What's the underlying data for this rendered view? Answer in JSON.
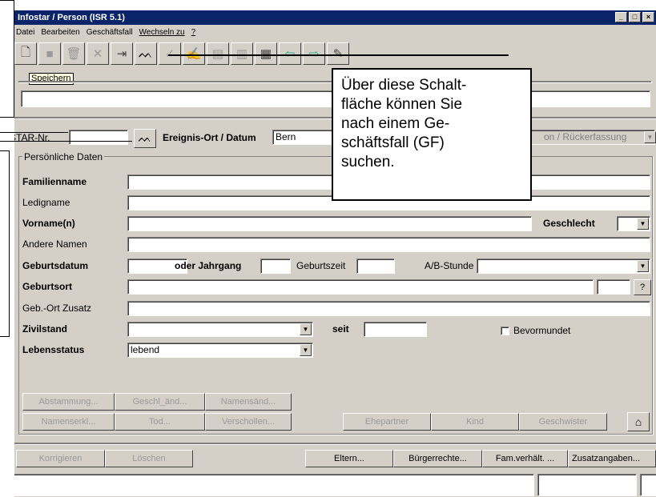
{
  "window": {
    "title": "Infostar / Person (ISR 5.1)",
    "min": "_",
    "max": "□",
    "close": "×"
  },
  "menu": [
    "Datei",
    "Bearbeiten",
    "Geschäftsfall",
    "Wechseln zu",
    "?"
  ],
  "toolbar": {
    "tooltip": "Speichern"
  },
  "search": {
    "star_label": "STAR-Nr.",
    "star_value": "",
    "ereignis_label": "Ereignis-Ort / Datum",
    "ereignis_value": "Bern",
    "combo_value": "on / Rückerfassung"
  },
  "section": {
    "title": "Persönliche Daten"
  },
  "labels": {
    "familienname": "Familienname",
    "ledigname": "Ledigname",
    "vorname": "Vorname(n)",
    "geschlecht": "Geschlecht",
    "andere": "Andere Namen",
    "geburtsdatum": "Geburtsdatum",
    "jahrgang": "oder Jahrgang",
    "geburtszeit": "Geburtszeit",
    "abstunde": "A/B-Stunde",
    "geburtsort": "Geburtsort",
    "zusatz": "Geb.-Ort Zusatz",
    "zivilstand": "Zivilstand",
    "seit": "seit",
    "bevormundet": "Bevormundet",
    "lebensstatus": "Lebensstatus"
  },
  "values": {
    "lebensstatus": "lebend",
    "geburtsort_btn": "?"
  },
  "buttons": {
    "abstammung": "Abstammung...",
    "geschl": "Geschl_änd...",
    "namensaend": "Namensänd...",
    "namenserkl": "Namenserkl...",
    "tod": "Tod...",
    "verschollen": "Verschollen...",
    "ehepartner": "Ehepartner",
    "kind": "Kind",
    "geschwister": "Geschwister",
    "korrigieren": "Korrigieren",
    "loeschen": "Löschen",
    "eltern": "Eltern...",
    "buergerrechte": "Bürgerrechte...",
    "famverh": "Fam.verhält. ...",
    "zusatzangaben": "Zusatzangaben..."
  },
  "callout": {
    "line1": "Über diese Schalt-",
    "line2": "fläche können Sie",
    "line3": "nach einem Ge-",
    "line4": "schäftsfall (GF)",
    "line5": "suchen."
  }
}
